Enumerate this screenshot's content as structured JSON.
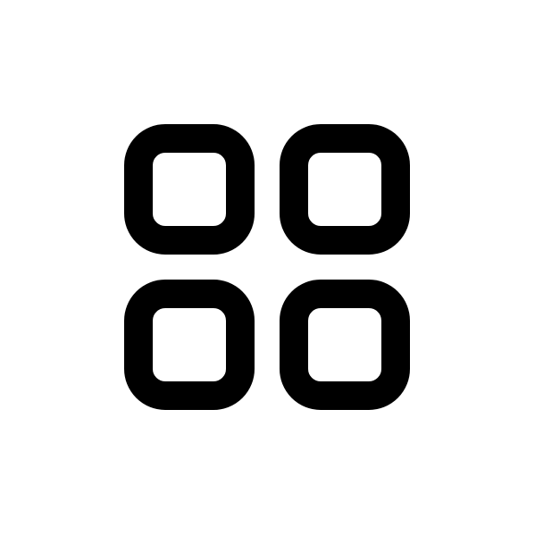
{
  "icon": {
    "name": "grid-icon",
    "tiles": [
      "top-left",
      "top-right",
      "bottom-left",
      "bottom-right"
    ]
  },
  "colors": {
    "background": "#ffffff",
    "stroke": "#000000"
  }
}
